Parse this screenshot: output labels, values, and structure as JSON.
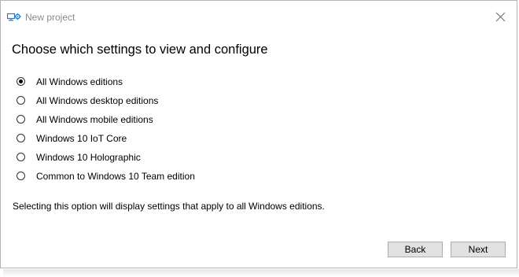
{
  "window": {
    "title": "New project",
    "icon": "project-settings-icon",
    "accent_color": "#1e7bd4"
  },
  "main": {
    "heading": "Choose which settings to view and configure",
    "options": [
      {
        "label": "All Windows editions",
        "selected": true
      },
      {
        "label": "All Windows desktop editions",
        "selected": false
      },
      {
        "label": "All Windows mobile editions",
        "selected": false
      },
      {
        "label": "Windows 10 IoT Core",
        "selected": false
      },
      {
        "label": "Windows 10 Holographic",
        "selected": false
      },
      {
        "label": "Common to Windows 10 Team edition",
        "selected": false
      }
    ],
    "description": "Selecting this option will display settings that apply to all Windows editions."
  },
  "footer": {
    "back_label": "Back",
    "next_label": "Next"
  }
}
